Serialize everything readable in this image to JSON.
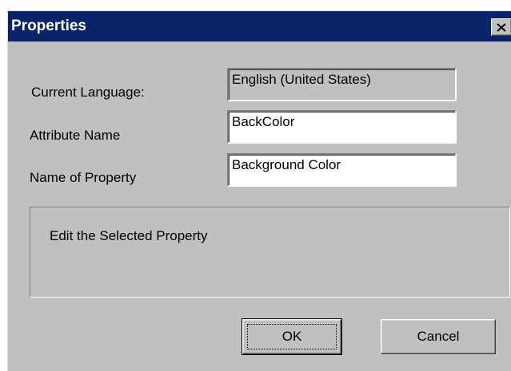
{
  "window": {
    "title": "Properties",
    "close_glyph": "✕",
    "titlebar_color": "#0a246a",
    "face_color": "#c0c0c0"
  },
  "form": {
    "current_language_label": "Current Language:",
    "current_language_value": "English (United States)",
    "attribute_name_label": "Attribute Name",
    "attribute_name_value": "BackColor",
    "property_name_label": "Name of Property",
    "property_name_value": "Background Color"
  },
  "description": {
    "text": "Edit the Selected Property"
  },
  "buttons": {
    "ok_label": "OK",
    "cancel_label": "Cancel"
  }
}
